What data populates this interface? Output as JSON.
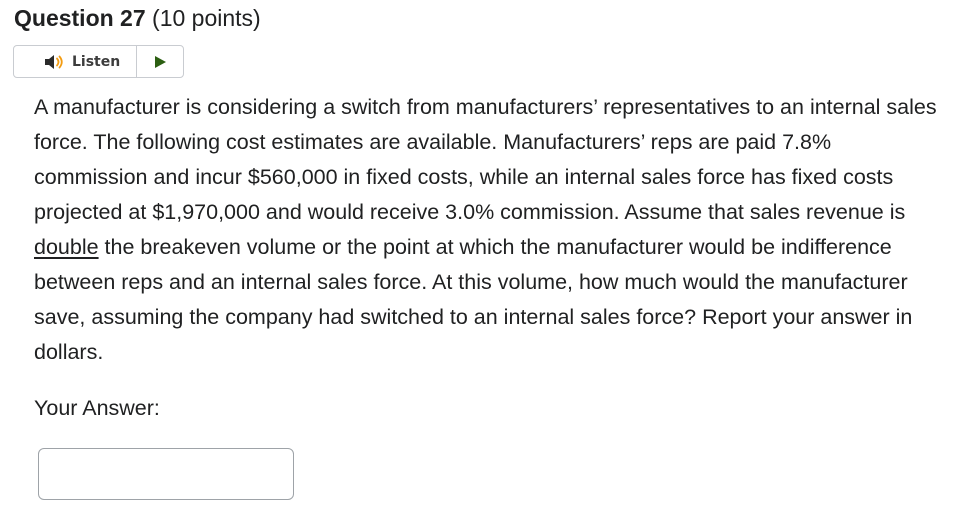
{
  "question": {
    "number_label": "Question 27",
    "points_label": "(10 points)"
  },
  "listen": {
    "label": "Listen",
    "speaker_icon": "speaker-icon",
    "play_icon": "play-icon",
    "play_color": "#2c5f12"
  },
  "body": {
    "text_before": "A manufacturer is considering a switch from manufacturers’ representatives to an internal sales force.  The following cost estimates are available.  Manufacturers’ reps are paid 7.8% commission and incur $560,000 in fixed costs, while an internal sales force has fixed costs projected at $1,970,000 and would receive 3.0% commission. Assume that sales revenue is ",
    "underlined": "double",
    "text_after": " the breakeven volume or the point at which the manufacturer would be indifference between reps and an internal sales force.  At this volume, how much would the manufacturer save, assuming the company had switched to an internal sales force?  Report your answer in dollars."
  },
  "answer": {
    "label": "Your Answer:",
    "value": "",
    "placeholder": ""
  }
}
